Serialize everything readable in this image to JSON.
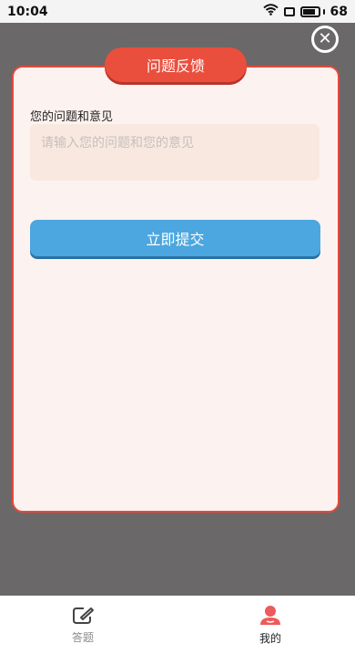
{
  "status_bar": {
    "time": "10:04",
    "battery_level": "68",
    "icons": [
      "wifi-icon",
      "screen-icon",
      "battery-icon"
    ]
  },
  "close_button": {
    "icon": "close-icon"
  },
  "modal": {
    "title": "问题反馈",
    "field_label": "您的问题和意见",
    "placeholder": "请输入您的问题和您的意见",
    "value": "",
    "submit_label": "立即提交"
  },
  "tabbar": {
    "items": [
      {
        "label": "答题",
        "icon": "edit-icon",
        "active": false
      },
      {
        "label": "我的",
        "icon": "user-icon",
        "active": true
      }
    ]
  },
  "colors": {
    "overlay": "#6a6868",
    "accent": "#ea4e3d",
    "button": "#4ca6df",
    "card": "#fcf3f0"
  }
}
